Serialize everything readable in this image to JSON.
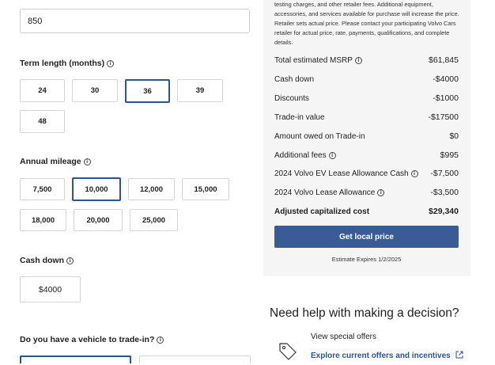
{
  "down_payment_input": {
    "value": "850"
  },
  "term": {
    "label": "Term length (months)",
    "options": [
      "24",
      "30",
      "36",
      "39",
      "48"
    ],
    "selected": "36"
  },
  "mileage": {
    "label": "Annual mileage",
    "options": [
      "7,500",
      "10,000",
      "12,000",
      "15,000",
      "18,000",
      "20,000",
      "25,000"
    ],
    "selected": "10,000"
  },
  "cash_down": {
    "label": "Cash down",
    "value": "$4000"
  },
  "trade_in": {
    "label": "Do you have a vehicle to trade-in?"
  },
  "summary": {
    "disclaimer": "testing charges, and other retailer fees. Additional equipment, accessories, and services available for purchase will increase the price. Retailer sets actual price. Please contact your participating Volvo Cars retailer for actual price, rate, payments, qualifications, and complete details.",
    "rows": [
      {
        "label": "Total estimated MSRP",
        "value": "$61,845",
        "info": true
      },
      {
        "label": "Cash down",
        "value": "-$4000",
        "info": false
      },
      {
        "label": "Discounts",
        "value": "-$1000",
        "info": false
      },
      {
        "label": "Trade-in value",
        "value": "-$17500",
        "info": false
      },
      {
        "label": "Amount owed on Trade-in",
        "value": "$0",
        "info": false
      },
      {
        "label": "Additional fees",
        "value": "$995",
        "info": true
      },
      {
        "label": "2024 Volvo EV Lease Allowance Cash",
        "value": "-$7,500",
        "info": true
      },
      {
        "label": "2024 Volvo Lease Allowance",
        "value": "-$3,500",
        "info": true
      },
      {
        "label": "Adjusted capitalized cost",
        "value": "$29,340",
        "info": false
      }
    ],
    "cta_label": "Get local price",
    "expires": "Estimate Expires 1/2/2025"
  },
  "help": {
    "title": "Need help with making a decision?",
    "offers_label": "View special offers",
    "offers_link": "Explore current offers and incentives"
  },
  "colors": {
    "accent": "#2c5593",
    "cta_bg": "#3a5c96",
    "panel_bg": "#f5f5f5"
  }
}
